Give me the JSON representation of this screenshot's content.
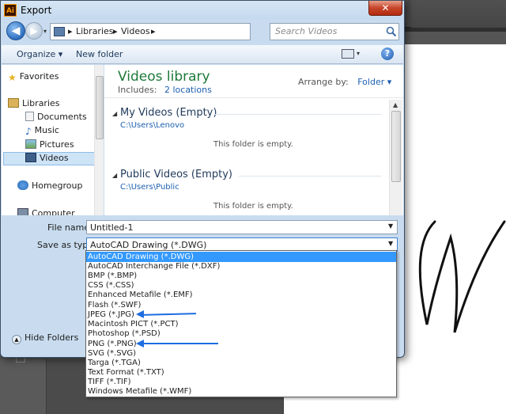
{
  "window": {
    "title": "Export",
    "app_icon": "Ai",
    "close_label": "✕"
  },
  "address_bar": {
    "crumbs": [
      "Libraries",
      "Videos"
    ],
    "search_placeholder": "Search Videos"
  },
  "toolbar": {
    "organize_label": "Organize ▾",
    "new_folder_label": "New folder",
    "help_label": "?"
  },
  "nav": {
    "items": [
      {
        "label": "Favorites",
        "icon": "star-icon"
      },
      {
        "label": "Libraries",
        "icon": "libraries-icon"
      },
      {
        "label": "Documents",
        "icon": "documents-icon"
      },
      {
        "label": "Music",
        "icon": "music-icon"
      },
      {
        "label": "Pictures",
        "icon": "pictures-icon"
      },
      {
        "label": "Videos",
        "icon": "videos-icon"
      },
      {
        "label": "Homegroup",
        "icon": "homegroup-icon"
      },
      {
        "label": "Computer",
        "icon": "computer-icon"
      }
    ]
  },
  "library": {
    "title": "Videos library",
    "includes_label": "Includes:",
    "includes_link": "2 locations",
    "arrange_label": "Arrange by:",
    "arrange_value": "Folder ▾",
    "groups": [
      {
        "title": "My Videos (Empty)",
        "path": "C:\\Users\\Lenovo",
        "empty_text": "This folder is empty."
      },
      {
        "title": "Public Videos (Empty)",
        "path": "C:\\Users\\Public",
        "empty_text": "This folder is empty."
      }
    ]
  },
  "form": {
    "file_name_label": "File name:",
    "file_name_value": "Untitled-1",
    "save_as_label": "Save as type:",
    "save_as_value": "AutoCAD Drawing (*.DWG)",
    "hide_folders_label": "Hide Folders"
  },
  "save_types": [
    "AutoCAD Drawing (*.DWG)",
    "AutoCAD Interchange File (*.DXF)",
    "BMP (*.BMP)",
    "CSS (*.CSS)",
    "Enhanced Metafile (*.EMF)",
    "Flash (*.SWF)",
    "JPEG (*.JPG)",
    "Macintosh PICT (*.PCT)",
    "Photoshop (*.PSD)",
    "PNG (*.PNG)",
    "SVG (*.SVG)",
    "Targa (*.TGA)",
    "Text Format (*.TXT)",
    "TIFF (*.TIF)",
    "Windows Metafile (*.WMF)"
  ],
  "colors": {
    "selection": "#3399ff",
    "annotation_arrow": "#1e6de0",
    "library_title": "#1e7a3a"
  }
}
